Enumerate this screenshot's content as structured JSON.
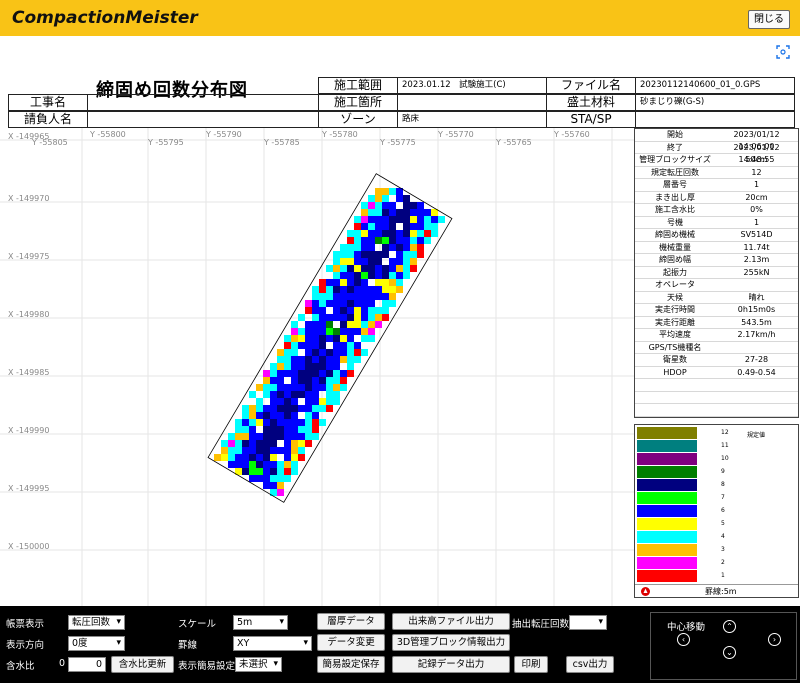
{
  "app": {
    "title": "CompactionMeister",
    "close_label": "閉じる",
    "fullscreen_icon": "fullscreen-icon"
  },
  "report": {
    "title": "締固め回数分布図",
    "labels": {
      "koji_name": "工事名",
      "contractor": "請負人名",
      "range": "施工範囲",
      "location": "施工箇所",
      "zone": "ゾーン",
      "file": "ファイル名",
      "material": "盛土材料",
      "sta": "STA/SP"
    },
    "values": {
      "range": "2023.01.12　試験施工(C)",
      "location": "",
      "zone": "路床",
      "file": "20230112140600_01_0.GPS",
      "material": "砂まじり礫(G-S)",
      "sta": "",
      "koji_name": "",
      "contractor": ""
    }
  },
  "map": {
    "x_labels": [
      "X -149965",
      "X -149970",
      "X -149975",
      "X -149980",
      "X -149985",
      "X -149990",
      "X -149995",
      "X -150000"
    ],
    "y_labels_top": [
      "Y -55800",
      "Y -55790",
      "Y -55780",
      "Y -55770",
      "Y -55760"
    ],
    "y_labels_bottom": [
      "Y -55805",
      "Y -55795",
      "Y -55785",
      "Y -55775",
      "Y -55765"
    ]
  },
  "info": [
    {
      "k": "開始",
      "v": "2023/01/12 14:06:00"
    },
    {
      "k": "終了",
      "v": "2023/01/12 14:48:55"
    },
    {
      "k": "管理ブロックサイズ",
      "v": "50cm"
    },
    {
      "k": "規定転圧回数",
      "v": "12"
    },
    {
      "k": "層番号",
      "v": "1"
    },
    {
      "k": "まき出し厚",
      "v": "20cm"
    },
    {
      "k": "施工含水比",
      "v": "0%"
    },
    {
      "k": "号機",
      "v": "1"
    },
    {
      "k": "締固め機械",
      "v": "SV514D"
    },
    {
      "k": "機械重量",
      "v": "11.74t"
    },
    {
      "k": "締固め幅",
      "v": "2.13m"
    },
    {
      "k": "起振力",
      "v": "255kN"
    },
    {
      "k": "オペレータ",
      "v": ""
    },
    {
      "k": "天候",
      "v": "晴れ"
    },
    {
      "k": "実走行時間",
      "v": "0h15m0s"
    },
    {
      "k": "実走行距離",
      "v": "543.5m"
    },
    {
      "k": "平均速度",
      "v": "2.17km/h"
    },
    {
      "k": "GPS/TS機種名",
      "v": ""
    },
    {
      "k": "衛星数",
      "v": "27-28"
    },
    {
      "k": "HDOP",
      "v": "0.49-0.54"
    },
    {
      "k": "",
      "v": ""
    },
    {
      "k": "",
      "v": ""
    },
    {
      "k": "",
      "v": ""
    }
  ],
  "legend": {
    "standard_label": "規定値",
    "footer": "罫線:5m",
    "items": [
      {
        "n": "12",
        "color": "#7f7f00"
      },
      {
        "n": "11",
        "color": "#007f7f"
      },
      {
        "n": "10",
        "color": "#7f007f"
      },
      {
        "n": "9",
        "color": "#007f00"
      },
      {
        "n": "8",
        "color": "#00007f"
      },
      {
        "n": "7",
        "color": "#00ff00"
      },
      {
        "n": "6",
        "color": "#0000ff"
      },
      {
        "n": "5",
        "color": "#ffff00"
      },
      {
        "n": "4",
        "color": "#00ffff"
      },
      {
        "n": "3",
        "color": "#ffc000"
      },
      {
        "n": "2",
        "color": "#ff00ff"
      },
      {
        "n": "1",
        "color": "#ff0000"
      }
    ]
  },
  "controls": {
    "form_label": "帳票表示",
    "form_value": "転圧回数",
    "dir_label": "表示方向",
    "dir_value": "0度",
    "moisture_label": "含水比",
    "moisture_zero": "0",
    "moisture_value": "0",
    "moisture_update": "含水比更新",
    "scale_label": "スケール",
    "scale_value": "5m",
    "line_label": "罫線",
    "line_value": "XY",
    "simple_label": "表示簡易設定",
    "simple_value": "未選択",
    "btn_layer": "層厚データ",
    "btn_change": "データ変更",
    "btn_save": "簡易設定保存",
    "btn_height": "出来高ファイル出力",
    "btn_3d": "3D管理ブロック情報出力",
    "btn_record": "記録データ出力",
    "extract_label": "抽出転圧回数",
    "btn_print": "印刷",
    "btn_csv": "csv出力",
    "center_move": "中心移動"
  }
}
